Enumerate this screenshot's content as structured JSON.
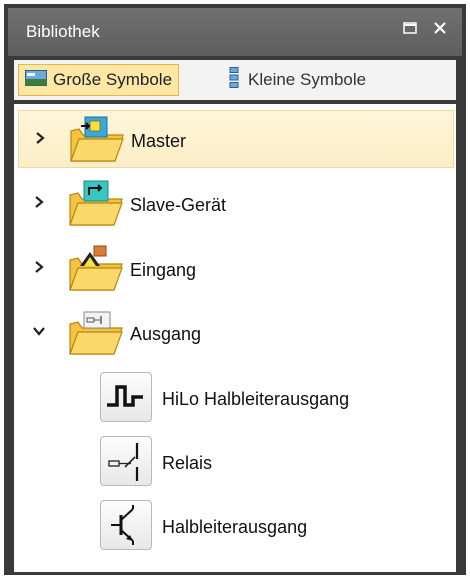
{
  "window": {
    "title": "Bibliothek"
  },
  "toolbar": {
    "large_icons_label": "Große Symbole",
    "small_icons_label": "Kleine Symbole"
  },
  "tree": {
    "items": [
      {
        "label": "Master",
        "expanded": false,
        "selected": true,
        "icon": "master-folder-icon"
      },
      {
        "label": "Slave-Gerät",
        "expanded": false,
        "selected": false,
        "icon": "slave-folder-icon"
      },
      {
        "label": "Eingang",
        "expanded": false,
        "selected": false,
        "icon": "input-folder-icon"
      },
      {
        "label": "Ausgang",
        "expanded": true,
        "selected": false,
        "icon": "output-folder-icon"
      }
    ],
    "children": [
      {
        "label": "HiLo Halbleiterausgang",
        "icon": "hilo-signal-icon"
      },
      {
        "label": "Relais",
        "icon": "relay-icon"
      },
      {
        "label": "Halbleiterausgang",
        "icon": "transistor-icon"
      }
    ]
  },
  "colors": {
    "title_bar": "#666666",
    "selection": "#fde7a6",
    "folder": "#f5c342"
  }
}
